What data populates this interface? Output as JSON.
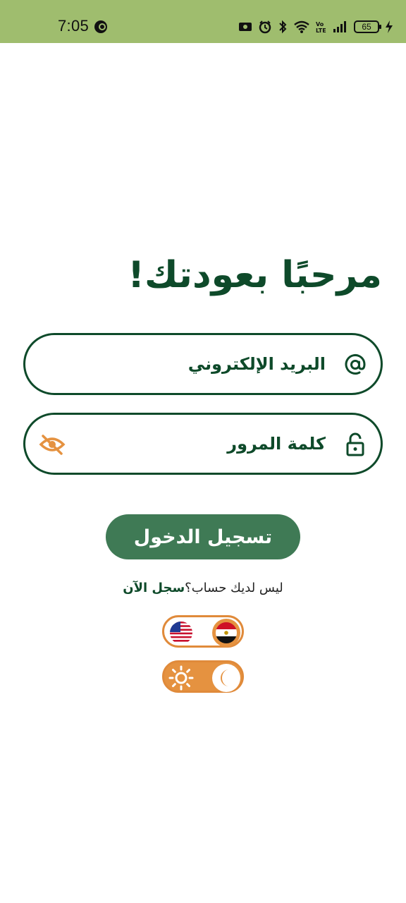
{
  "status_bar": {
    "time": "7:05",
    "battery": "65",
    "bg_color": "#9fbd6e"
  },
  "login": {
    "heading": "مرحبًا بعودتك!",
    "email_placeholder": "البريد الإلكتروني",
    "email_value": "",
    "password_placeholder": "كلمة المرور",
    "password_value": "",
    "login_button": "تسجيل الدخول",
    "signup_prompt": "ليس لديك حساب؟",
    "signup_link": "سجل الآن"
  },
  "toggles": {
    "language": {
      "active": "egypt-flag",
      "inactive": "us-flag"
    },
    "theme": {
      "active": "moon-icon",
      "inactive": "sun-icon"
    }
  },
  "colors": {
    "primary": "#0e4a2a",
    "button": "#3f7a55",
    "accent": "#e59240"
  }
}
